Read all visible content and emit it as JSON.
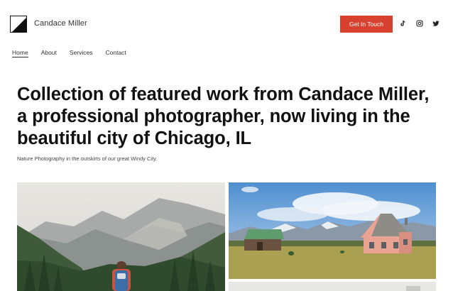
{
  "brand": {
    "name": "Candace Miller"
  },
  "header": {
    "cta_label": "Get In Touch",
    "social": [
      {
        "icon": "tiktok-icon"
      },
      {
        "icon": "instagram-icon"
      },
      {
        "icon": "twitter-icon"
      }
    ]
  },
  "nav": {
    "items": [
      {
        "label": "Home",
        "active": true
      },
      {
        "label": "About",
        "active": false
      },
      {
        "label": "Services",
        "active": false
      },
      {
        "label": "Contact",
        "active": false
      }
    ]
  },
  "hero": {
    "headline": "Collection of featured work from Candace Miller, a professional photographer, now living in the beautiful city of Chicago, IL",
    "subline": "Nature Photography in the outskirts of our great Windy City."
  },
  "colors": {
    "accent": "#d9412f",
    "text": "#111111"
  }
}
